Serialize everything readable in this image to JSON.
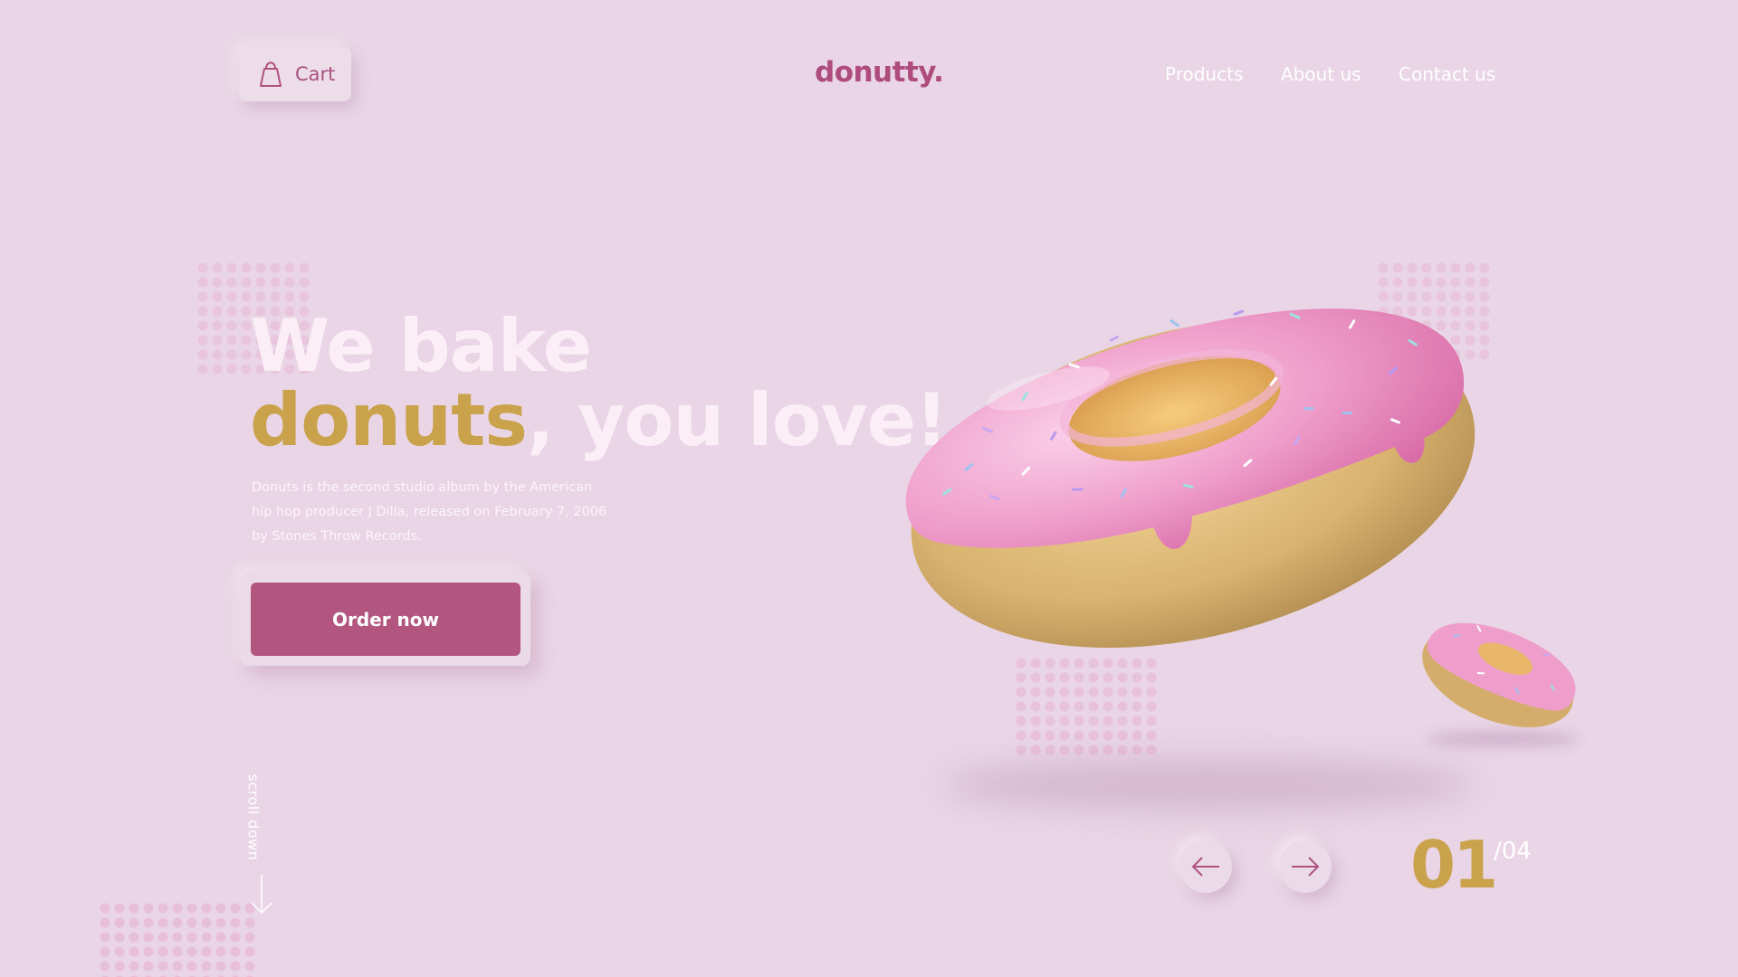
{
  "header": {
    "cart_label": "Cart",
    "logo": "donutty.",
    "nav": [
      {
        "label": "Products"
      },
      {
        "label": "About us"
      },
      {
        "label": "Contact us"
      }
    ]
  },
  "hero": {
    "headline_line1": "We bake",
    "headline_highlight": "donuts",
    "headline_rest": ", you love!",
    "description": "Donuts is the second studio album by the American hip hop producer J Dilla, released on February 7, 2006 by Stones Throw Records.",
    "cta_label": "Order now",
    "scroll_label": "scroll down"
  },
  "slider": {
    "current": "01",
    "total": "/04"
  },
  "icons": {
    "cart": "bag-icon",
    "prev": "arrow-left-icon",
    "next": "arrow-right-icon",
    "scroll": "arrow-down-icon"
  },
  "colors": {
    "background": "#e9d5e5",
    "brand": "#ae4c7d",
    "button": "#b2567f",
    "accent_gold": "#c9a24b",
    "text_light": "#ffffff"
  }
}
